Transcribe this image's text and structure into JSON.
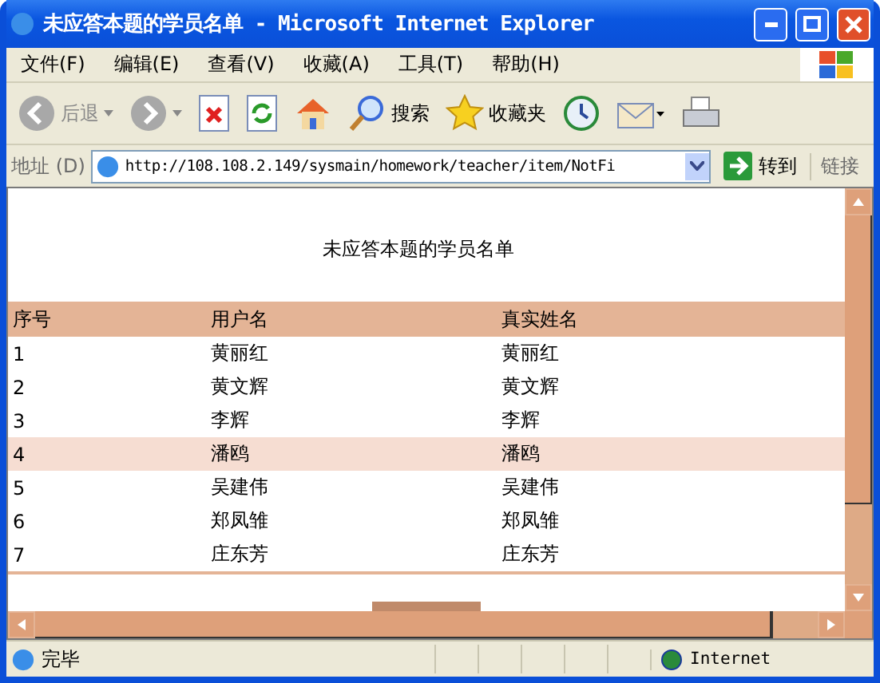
{
  "window": {
    "title": "未应答本题的学员名单 - Microsoft Internet Explorer"
  },
  "menu": [
    "文件(F)",
    "编辑(E)",
    "查看(V)",
    "收藏(A)",
    "工具(T)",
    "帮助(H)"
  ],
  "toolbar": [
    {
      "kind": "back",
      "label": "后退",
      "disabled": true
    },
    {
      "kind": "forward",
      "disabled": true
    },
    {
      "kind": "stop"
    },
    {
      "kind": "refresh"
    },
    {
      "kind": "home"
    },
    {
      "kind": "search",
      "label": "搜索"
    },
    {
      "kind": "favorites",
      "label": "收藏夹"
    },
    {
      "kind": "history"
    },
    {
      "kind": "mail"
    },
    {
      "kind": "print"
    }
  ],
  "address": {
    "label": "地址 (D)",
    "value": "http://108.108.2.149/sysmain/homework/teacher/item/NotFi",
    "go": "转到",
    "links": "链接"
  },
  "page": {
    "heading": "未应答本题的学员名单",
    "columns": [
      "序号",
      "用户名",
      "真实姓名"
    ],
    "rows": [
      {
        "cells": [
          "1",
          "黄丽红",
          "黄丽红"
        ],
        "selected": false
      },
      {
        "cells": [
          "2",
          "黄文辉",
          "黄文辉"
        ],
        "selected": false
      },
      {
        "cells": [
          "3",
          "李辉",
          "李辉"
        ],
        "selected": false
      },
      {
        "cells": [
          "4",
          "潘鸥",
          "潘鸥"
        ],
        "selected": true
      },
      {
        "cells": [
          "5",
          "吴建伟",
          "吴建伟"
        ],
        "selected": false
      },
      {
        "cells": [
          "6",
          "郑凤雏",
          "郑凤雏"
        ],
        "selected": false
      },
      {
        "cells": [
          "7",
          "庄东芳",
          "庄东芳"
        ],
        "selected": false
      }
    ]
  },
  "status_bar": {
    "text": "完毕",
    "zone": "Internet"
  }
}
